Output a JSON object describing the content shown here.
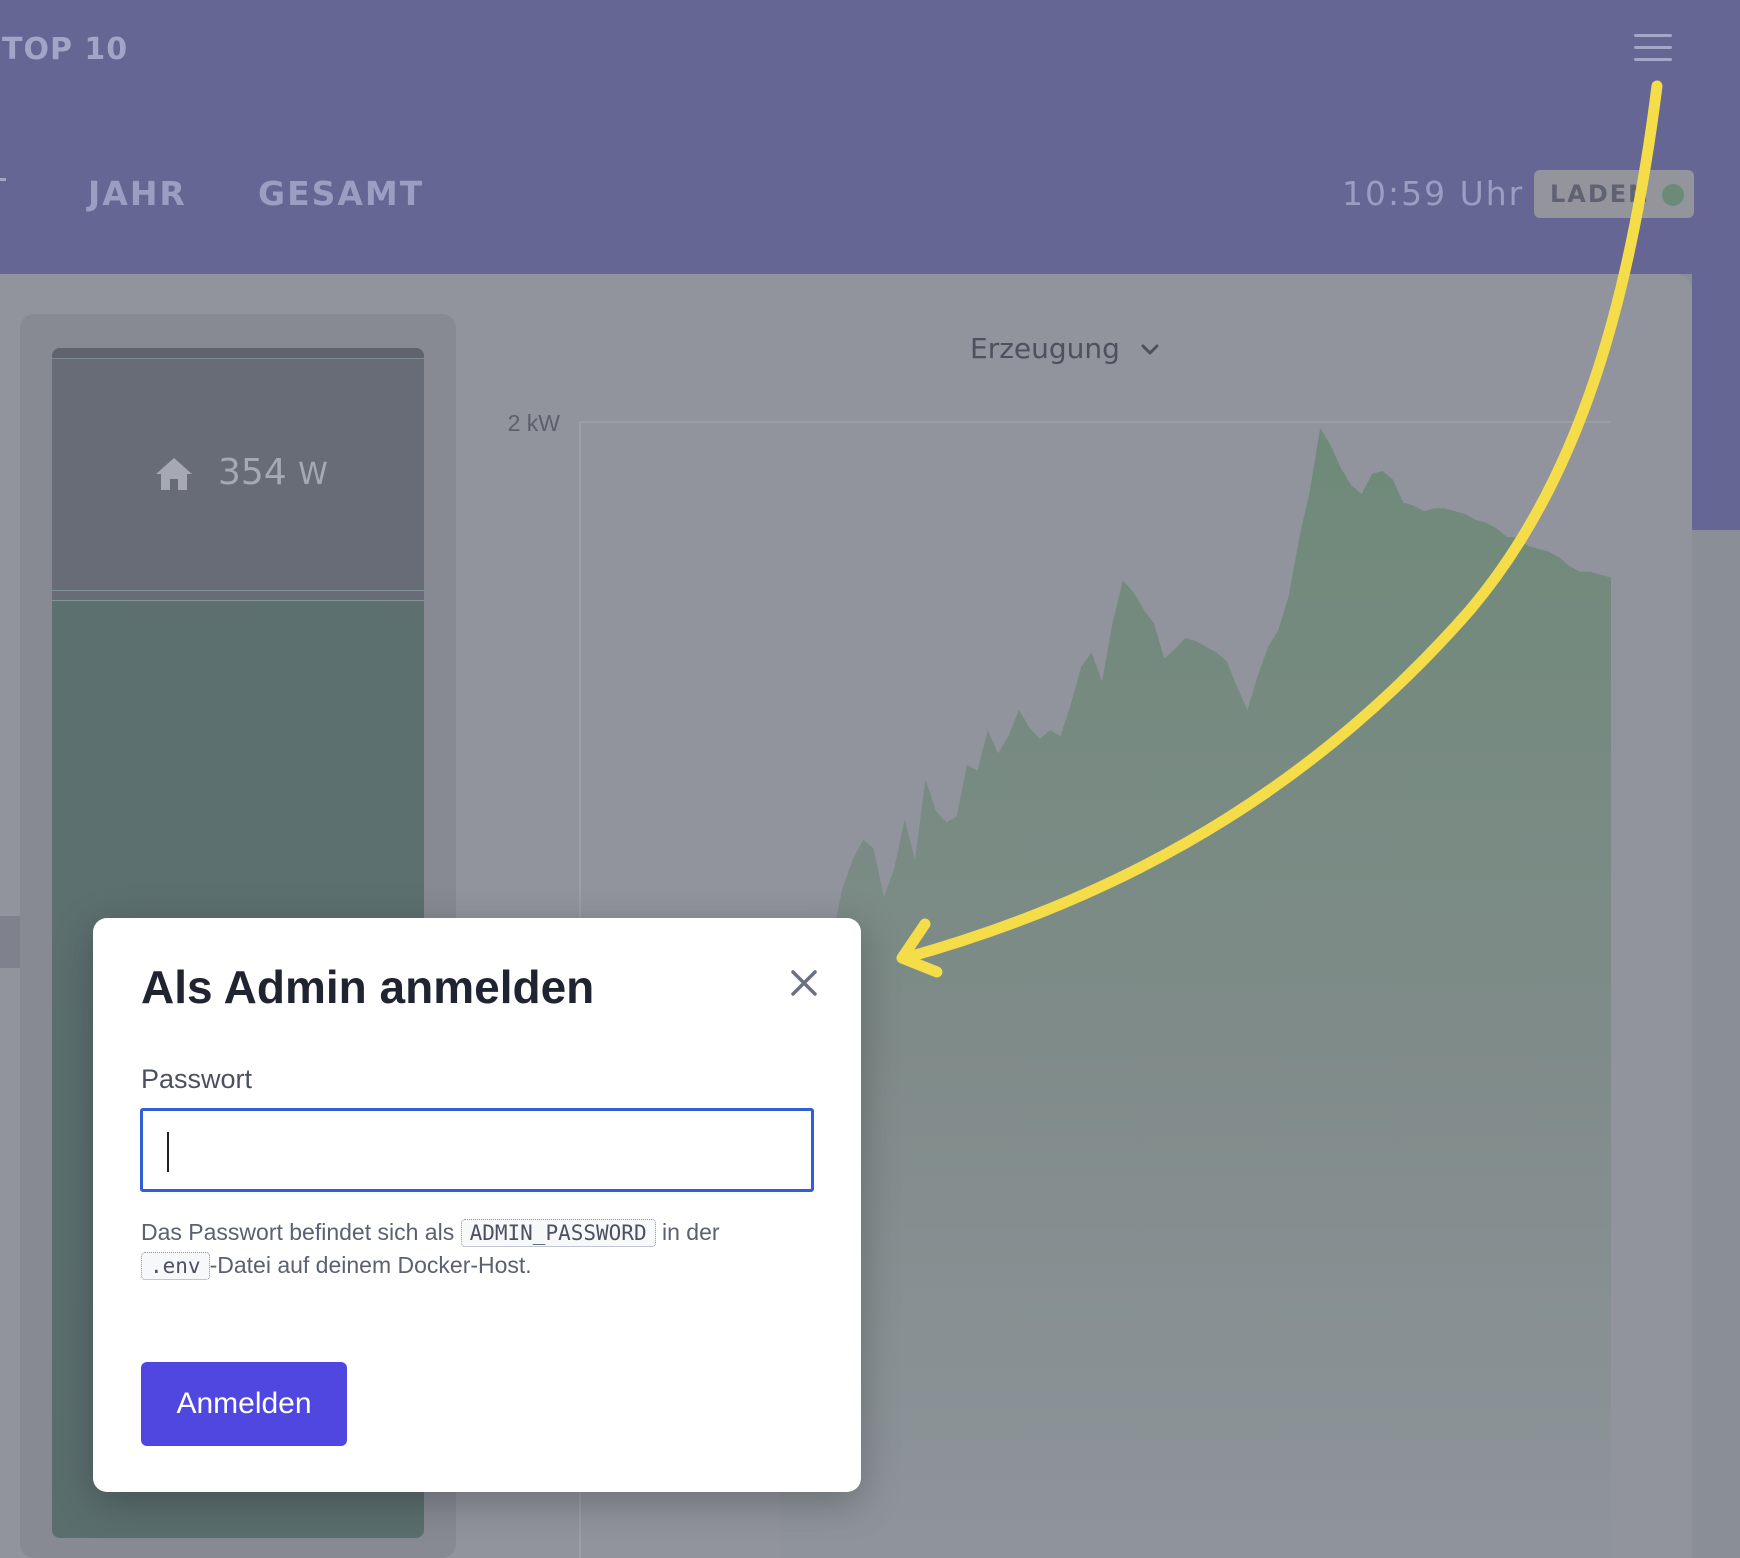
{
  "header": {
    "brand_label": "TOP 10",
    "menu_icon": "hamburger-icon"
  },
  "tabs": [
    {
      "label": "JAHR"
    },
    {
      "label": "GESAMT"
    }
  ],
  "status": {
    "time": "10:59 Uhr",
    "charge_label": "LADEN",
    "charge_color": "#6c8a78"
  },
  "house": {
    "icon": "house-icon",
    "value": "354",
    "unit": "W"
  },
  "chart": {
    "selector_label": "Erzeugung",
    "selector_icon": "chevron-down-icon"
  },
  "chart_data": {
    "type": "area",
    "title": "",
    "xlabel": "",
    "ylabel": "",
    "y_tick_labels": [
      "2 kW"
    ],
    "color": "#6f8a79",
    "x": [
      0,
      1,
      2,
      3,
      4,
      5,
      6,
      7,
      8,
      9,
      10,
      11,
      12,
      13,
      14,
      15,
      16,
      17,
      18,
      19,
      20,
      21,
      22,
      23,
      24,
      25,
      26,
      27,
      28,
      29,
      30,
      31,
      32,
      33,
      34,
      35,
      36,
      37,
      38,
      39,
      40,
      41,
      42,
      43,
      44,
      45,
      46,
      47,
      48,
      49,
      50,
      51,
      52,
      53,
      54,
      55,
      56,
      57,
      58,
      59,
      60,
      61,
      62,
      63,
      64,
      65,
      66,
      67,
      68,
      69,
      70,
      71,
      72,
      73,
      74,
      75,
      76,
      77,
      78,
      79,
      80
    ],
    "values": [
      0.03,
      0.06,
      0.1,
      0.12,
      0.11,
      0.2,
      0.38,
      0.48,
      0.55,
      0.52,
      0.35,
      0.45,
      0.62,
      0.48,
      0.76,
      0.65,
      0.61,
      0.63,
      0.81,
      0.79,
      0.93,
      0.85,
      0.91,
      1.0,
      0.94,
      0.9,
      0.93,
      0.91,
      1.02,
      1.15,
      1.2,
      1.1,
      1.3,
      1.45,
      1.41,
      1.35,
      1.3,
      1.18,
      1.21,
      1.25,
      1.24,
      1.22,
      1.2,
      1.17,
      1.08,
      1.0,
      1.12,
      1.22,
      1.28,
      1.4,
      1.6,
      1.76,
      1.98,
      1.92,
      1.84,
      1.78,
      1.75,
      1.82,
      1.83,
      1.8,
      1.72,
      1.71,
      1.69,
      1.7,
      1.7,
      1.69,
      1.68,
      1.66,
      1.65,
      1.63,
      1.6,
      1.6,
      1.57,
      1.56,
      1.55,
      1.53,
      1.5,
      1.48,
      1.48,
      1.47,
      1.46
    ],
    "ylim": [
      0,
      2
    ],
    "grid": true,
    "legend": "none"
  },
  "modal": {
    "title": "Als Admin anmelden",
    "close_icon": "close-icon",
    "password_label": "Passwort",
    "password_value": "",
    "hint_before": "Das Passwort befindet sich als ",
    "hint_code_1": "ADMIN_PASSWORD",
    "hint_middle": " in der ",
    "hint_code_2": ".env",
    "hint_after": "-Datei auf deinem Docker-Host.",
    "submit_label": "Anmelden",
    "submit_color": "#5046e0"
  },
  "annotation": {
    "arrow_color": "#f5dd4a"
  }
}
